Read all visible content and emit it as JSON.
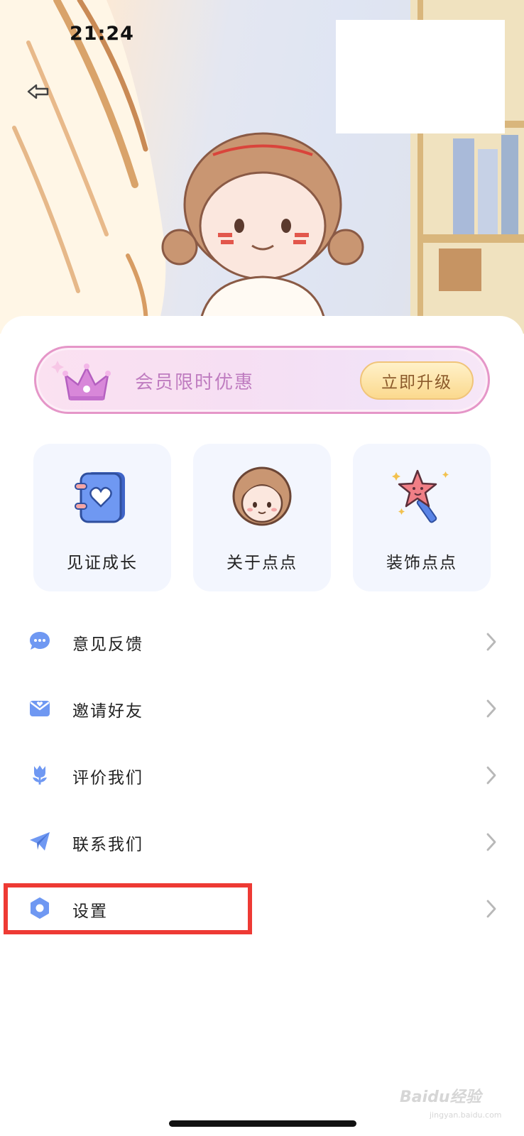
{
  "status_bar": {
    "time": "21:24"
  },
  "header": {
    "back_icon": "back-arrow-icon"
  },
  "vip_banner": {
    "icon": "crown-icon",
    "text": "会员限时优惠",
    "button_label": "立即升级",
    "colors": {
      "border": "#e596c8",
      "text": "#bf7cc0",
      "button_text": "#8b5a2b"
    }
  },
  "features": [
    {
      "icon": "heart-notebook-icon",
      "label": "见证成长"
    },
    {
      "icon": "girl-avatar-icon",
      "label": "关于点点"
    },
    {
      "icon": "star-wand-icon",
      "label": "装饰点点"
    }
  ],
  "menu": [
    {
      "icon": "chat-bubble-icon",
      "label": "意见反馈"
    },
    {
      "icon": "envelope-icon",
      "label": "邀请好友"
    },
    {
      "icon": "tulip-icon",
      "label": "评价我们"
    },
    {
      "icon": "paper-plane-icon",
      "label": "联系我们"
    },
    {
      "icon": "settings-icon",
      "label": "设置"
    }
  ],
  "watermark": {
    "text": "Baidu经验",
    "url": "jingyan.baidu.com"
  },
  "accent_color": "#6f98f2",
  "highlight_color": "#ee3a34"
}
